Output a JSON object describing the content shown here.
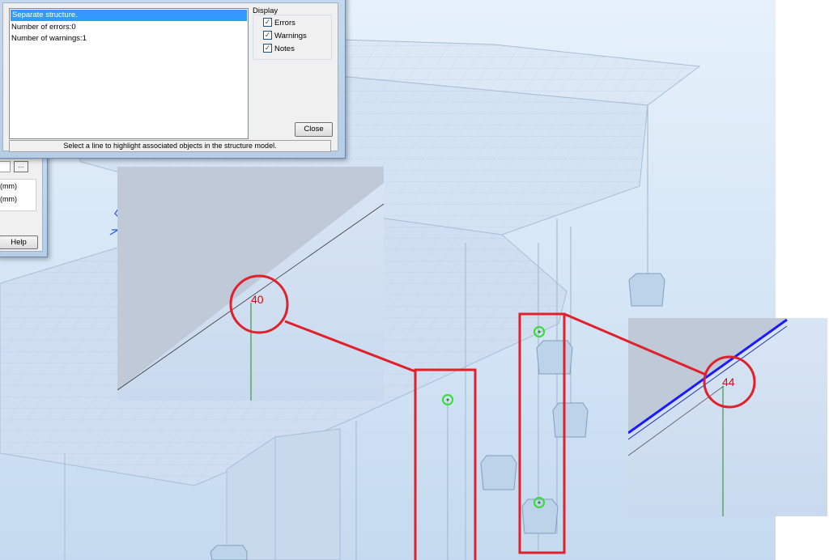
{
  "results_dialog": {
    "messages": [
      "Separate structure.",
      "Number of errors:0",
      "Number of warnings:1"
    ],
    "display": {
      "legend": "Display",
      "options": [
        {
          "label": "Errors",
          "checked": true
        },
        {
          "label": "Warnings",
          "checked": true
        },
        {
          "label": "Notes",
          "checked": true
        }
      ]
    },
    "close_label": "Close",
    "status_text": "Select a line to highlight associated objects in the structure model."
  },
  "background_dialog": {
    "browse_label": "...",
    "unit_rows": [
      "(mm)",
      "(mm)"
    ],
    "help_label": "Help"
  },
  "zoom_callouts": {
    "left_node_label": "40",
    "right_node_label": "44"
  },
  "colors": {
    "highlight_red": "#e0202a",
    "node_green": "#33dd33",
    "selection_blue": "#1a1aff"
  }
}
